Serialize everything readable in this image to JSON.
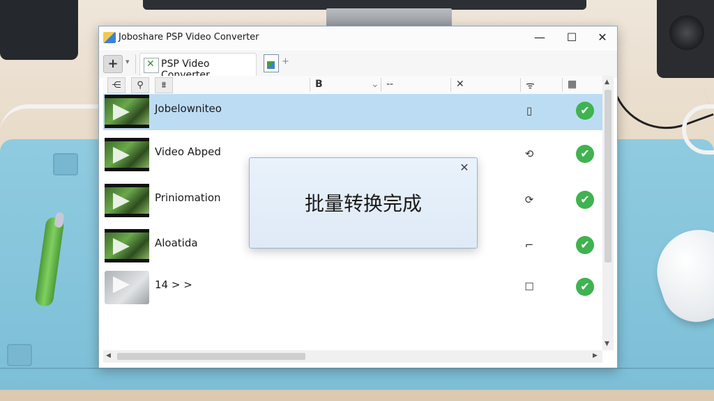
{
  "window": {
    "title": "Joboshare PSP Video Converter",
    "controls": {
      "minimize": "—",
      "maximize": "☐",
      "close": "✕"
    }
  },
  "toolbar": {
    "add_label": "+",
    "add_caret": "▾",
    "tab_label": "PSP Video Converter",
    "new_tab_label": "+"
  },
  "header": {
    "tool_buttons": [
      "⋲",
      "⚲",
      "⩩"
    ],
    "col_b": "B",
    "col_b_caret": "⌄",
    "col_dash": "--",
    "col_x": "✕",
    "col_signal": "ᯤ",
    "col_grid": "▦"
  },
  "files": [
    {
      "name": "Jobelowniteo",
      "status_icon": "▯",
      "thumb": "video",
      "selected": true
    },
    {
      "name": "Video Abped",
      "status_icon": "⟲",
      "thumb": "video",
      "selected": false
    },
    {
      "name": "Priniomation",
      "status_icon": "⟳",
      "thumb": "video",
      "selected": false
    },
    {
      "name": "Aloatida",
      "status_icon": "⌐",
      "thumb": "video",
      "selected": false
    },
    {
      "name": "14  >  >",
      "status_icon": "☐",
      "thumb": "generic",
      "selected": false
    }
  ],
  "done_mark": "✔",
  "dialog": {
    "message": "批量转换完成",
    "close": "✕"
  },
  "scroll": {
    "up": "▲",
    "down": "▼",
    "left": "◀",
    "right": "▶"
  },
  "colors": {
    "selected_row": "#bcdcf3",
    "check_green": "#3fb34f",
    "dialog_bg": "#e4eef9"
  }
}
